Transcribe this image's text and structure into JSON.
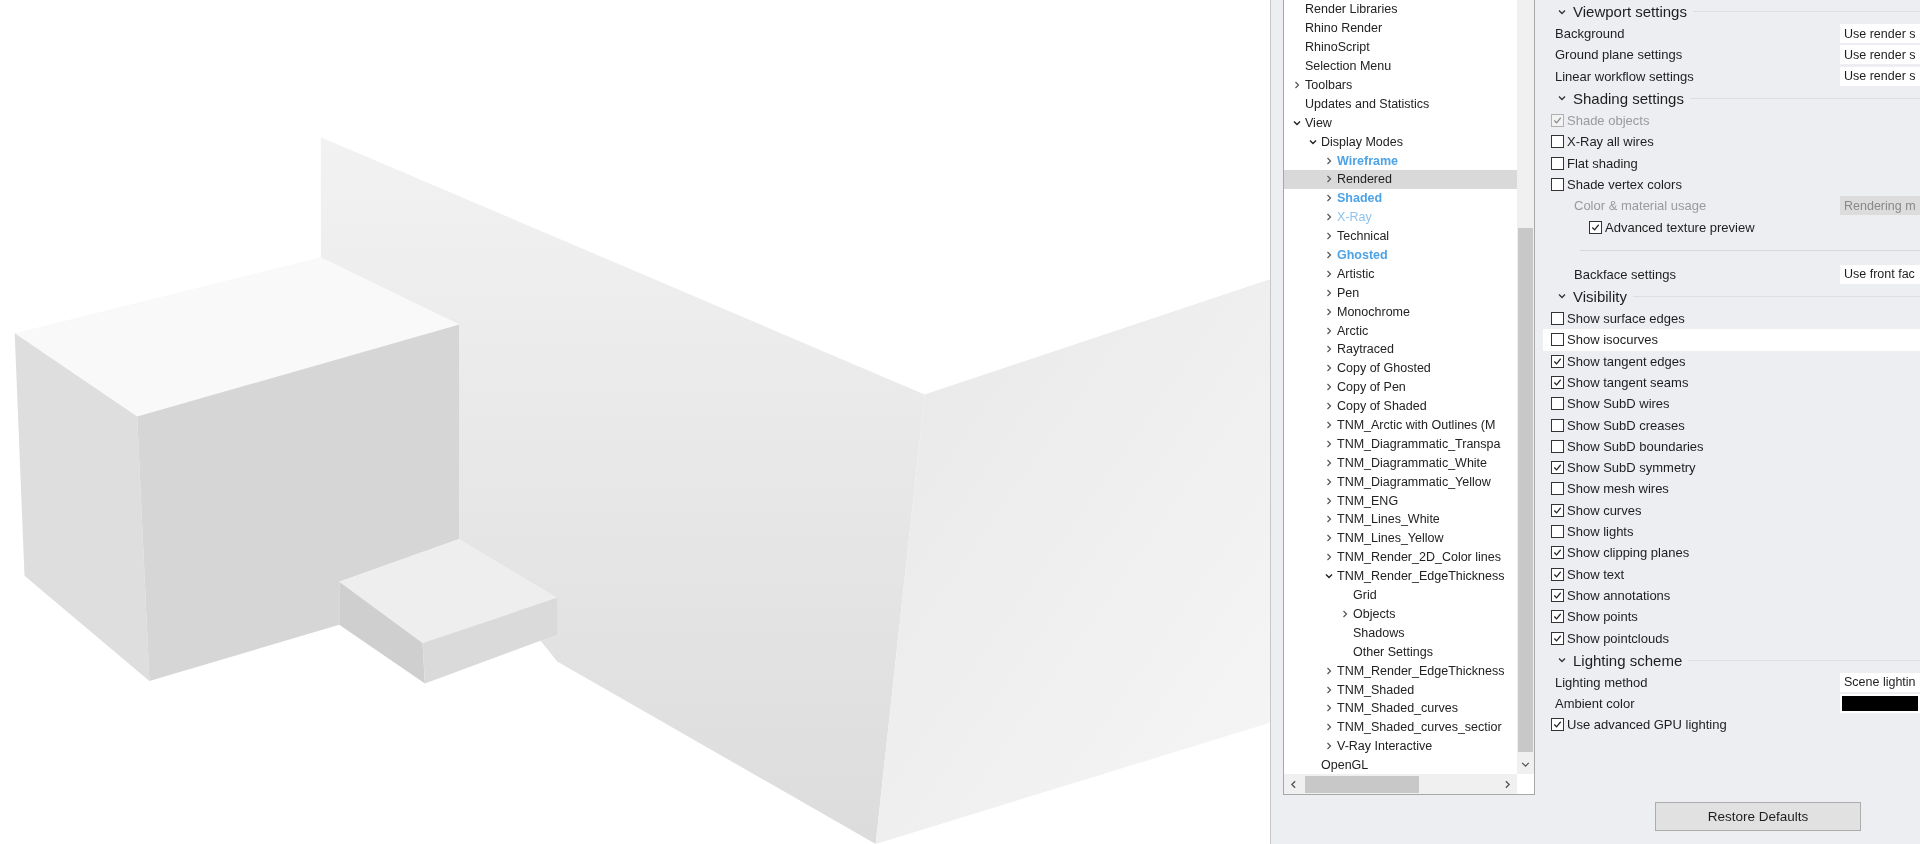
{
  "tree": {
    "items": [
      {
        "label": "Render Libraries",
        "selected": false
      },
      {
        "label": "Rhino Render",
        "selected": false
      },
      {
        "label": "RhinoScript",
        "selected": false
      },
      {
        "label": "Selection Menu",
        "selected": false
      },
      {
        "label": "Toolbars",
        "selected": false,
        "expanded": false
      },
      {
        "label": "Updates and Statistics",
        "selected": false
      },
      {
        "label": "View",
        "selected": false,
        "expanded": true,
        "children": [
          {
            "label": "Display Modes",
            "selected": false,
            "expanded": true,
            "children": [
              {
                "label": "Wireframe",
                "selected": false,
                "expanded": false,
                "kind": "bold"
              },
              {
                "label": "Rendered",
                "selected": true,
                "expanded": false,
                "kind": "plain"
              },
              {
                "label": "Shaded",
                "selected": false,
                "expanded": false,
                "kind": "bold"
              },
              {
                "label": "X-Ray",
                "selected": false,
                "expanded": false,
                "kind": "faint"
              },
              {
                "label": "Technical",
                "selected": false,
                "expanded": false,
                "kind": "plain"
              },
              {
                "label": "Ghosted",
                "selected": false,
                "expanded": false,
                "kind": "bold"
              },
              {
                "label": "Artistic",
                "selected": false,
                "expanded": false,
                "kind": "plain"
              },
              {
                "label": "Pen",
                "selected": false,
                "expanded": false,
                "kind": "plain"
              },
              {
                "label": "Monochrome",
                "selected": false,
                "expanded": false,
                "kind": "plain"
              },
              {
                "label": "Arctic",
                "selected": false,
                "expanded": false,
                "kind": "plain"
              },
              {
                "label": "Raytraced",
                "selected": false,
                "expanded": false,
                "kind": "plain"
              },
              {
                "label": "Copy of Ghosted",
                "selected": false,
                "expanded": false,
                "kind": "plain"
              },
              {
                "label": "Copy of Pen",
                "selected": false,
                "expanded": false,
                "kind": "plain"
              },
              {
                "label": "Copy of Shaded",
                "selected": false,
                "expanded": false,
                "kind": "plain"
              },
              {
                "label": "TNM_Arctic with Outlines (M",
                "selected": false,
                "expanded": false,
                "kind": "plain"
              },
              {
                "label": "TNM_Diagrammatic_Transpa",
                "selected": false,
                "expanded": false,
                "kind": "plain"
              },
              {
                "label": "TNM_Diagrammatic_White",
                "selected": false,
                "expanded": false,
                "kind": "plain"
              },
              {
                "label": "TNM_Diagrammatic_Yellow",
                "selected": false,
                "expanded": false,
                "kind": "plain"
              },
              {
                "label": "TNM_ENG",
                "selected": false,
                "expanded": false,
                "kind": "plain"
              },
              {
                "label": "TNM_Lines_White",
                "selected": false,
                "expanded": false,
                "kind": "plain"
              },
              {
                "label": "TNM_Lines_Yellow",
                "selected": false,
                "expanded": false,
                "kind": "plain"
              },
              {
                "label": "TNM_Render_2D_Color lines",
                "selected": false,
                "expanded": false,
                "kind": "plain"
              },
              {
                "label": "TNM_Render_EdgeThickness",
                "selected": false,
                "expanded": true,
                "kind": "plain",
                "children": [
                  {
                    "label": "Grid",
                    "selected": false
                  },
                  {
                    "label": "Objects",
                    "selected": false,
                    "expanded": false
                  },
                  {
                    "label": "Shadows",
                    "selected": false
                  },
                  {
                    "label": "Other Settings",
                    "selected": false
                  }
                ]
              },
              {
                "label": "TNM_Render_EdgeThickness",
                "selected": false,
                "expanded": false,
                "kind": "plain"
              },
              {
                "label": "TNM_Shaded",
                "selected": false,
                "expanded": false,
                "kind": "plain"
              },
              {
                "label": "TNM_Shaded_curves",
                "selected": false,
                "expanded": false,
                "kind": "plain"
              },
              {
                "label": "TNM_Shaded_curves_sectior",
                "selected": false,
                "expanded": false,
                "kind": "plain"
              },
              {
                "label": "V-Ray Interactive",
                "selected": false,
                "expanded": false,
                "kind": "plain"
              }
            ]
          },
          {
            "label": "OpenGL",
            "selected": false
          }
        ]
      }
    ]
  },
  "settings": {
    "sections": [
      {
        "title": "Viewport settings",
        "expanded": true,
        "rows": [
          {
            "kind": "value",
            "label": "Background",
            "value": "Use render s",
            "disabled": false
          },
          {
            "kind": "value",
            "label": "Ground plane settings",
            "value": "Use render s",
            "disabled": false
          },
          {
            "kind": "value",
            "label": "Linear workflow settings",
            "value": "Use render s",
            "disabled": false
          }
        ]
      },
      {
        "title": "Shading settings",
        "expanded": true,
        "rows": [
          {
            "kind": "check",
            "label": "Shade objects",
            "checked": true,
            "disabled": true
          },
          {
            "kind": "check",
            "label": "X-Ray all wires",
            "checked": false,
            "disabled": false
          },
          {
            "kind": "check",
            "label": "Flat shading",
            "checked": false,
            "disabled": false
          },
          {
            "kind": "check",
            "label": "Shade vertex colors",
            "checked": false,
            "disabled": false
          },
          {
            "kind": "group",
            "children": [
              {
                "kind": "value",
                "label": "Color & material usage",
                "value": "Rendering m",
                "disabled": true
              },
              {
                "kind": "group",
                "children": [
                  {
                    "kind": "check",
                    "label": "Advanced texture preview",
                    "checked": true,
                    "disabled": false
                  }
                ]
              },
              {
                "kind": "separator"
              },
              {
                "kind": "value",
                "label": "Backface settings",
                "value": "Use front fac",
                "disabled": false
              }
            ]
          }
        ]
      },
      {
        "title": "Visibility",
        "expanded": true,
        "rows": [
          {
            "kind": "check",
            "label": "Show surface edges",
            "checked": false,
            "disabled": false,
            "highlighted": false
          },
          {
            "kind": "check",
            "label": "Show isocurves",
            "checked": false,
            "disabled": false,
            "highlighted": true
          },
          {
            "kind": "check",
            "label": "Show tangent edges",
            "checked": true,
            "disabled": false,
            "highlighted": false
          },
          {
            "kind": "check",
            "label": "Show tangent seams",
            "checked": true,
            "disabled": false,
            "highlighted": false
          },
          {
            "kind": "check",
            "label": "Show SubD wires",
            "checked": false,
            "disabled": false,
            "highlighted": false
          },
          {
            "kind": "check",
            "label": "Show SubD creases",
            "checked": false,
            "disabled": false,
            "highlighted": false
          },
          {
            "kind": "check",
            "label": "Show SubD boundaries",
            "checked": false,
            "disabled": false,
            "highlighted": false
          },
          {
            "kind": "check",
            "label": "Show SubD symmetry",
            "checked": true,
            "disabled": false,
            "highlighted": false
          },
          {
            "kind": "check",
            "label": "Show mesh wires",
            "checked": false,
            "disabled": false,
            "highlighted": false
          },
          {
            "kind": "check",
            "label": "Show curves",
            "checked": true,
            "disabled": false,
            "highlighted": false
          },
          {
            "kind": "check",
            "label": "Show lights",
            "checked": false,
            "disabled": false,
            "highlighted": false
          },
          {
            "kind": "check",
            "label": "Show clipping planes",
            "checked": true,
            "disabled": false,
            "highlighted": false
          },
          {
            "kind": "check",
            "label": "Show text",
            "checked": true,
            "disabled": false,
            "highlighted": false
          },
          {
            "kind": "check",
            "label": "Show annotations",
            "checked": true,
            "disabled": false,
            "highlighted": false
          },
          {
            "kind": "check",
            "label": "Show points",
            "checked": true,
            "disabled": false,
            "highlighted": false
          },
          {
            "kind": "check",
            "label": "Show pointclouds",
            "checked": true,
            "disabled": false,
            "highlighted": false
          }
        ]
      },
      {
        "title": "Lighting scheme",
        "expanded": true,
        "rows": [
          {
            "kind": "value",
            "label": "Lighting method",
            "value": "Scene lightin",
            "disabled": false
          },
          {
            "kind": "color",
            "label": "Ambient color",
            "color": "#000000"
          },
          {
            "kind": "check",
            "label": "Use advanced GPU lighting",
            "checked": true,
            "disabled": false
          }
        ]
      }
    ]
  },
  "buttons": {
    "restore": "Restore Defaults"
  }
}
